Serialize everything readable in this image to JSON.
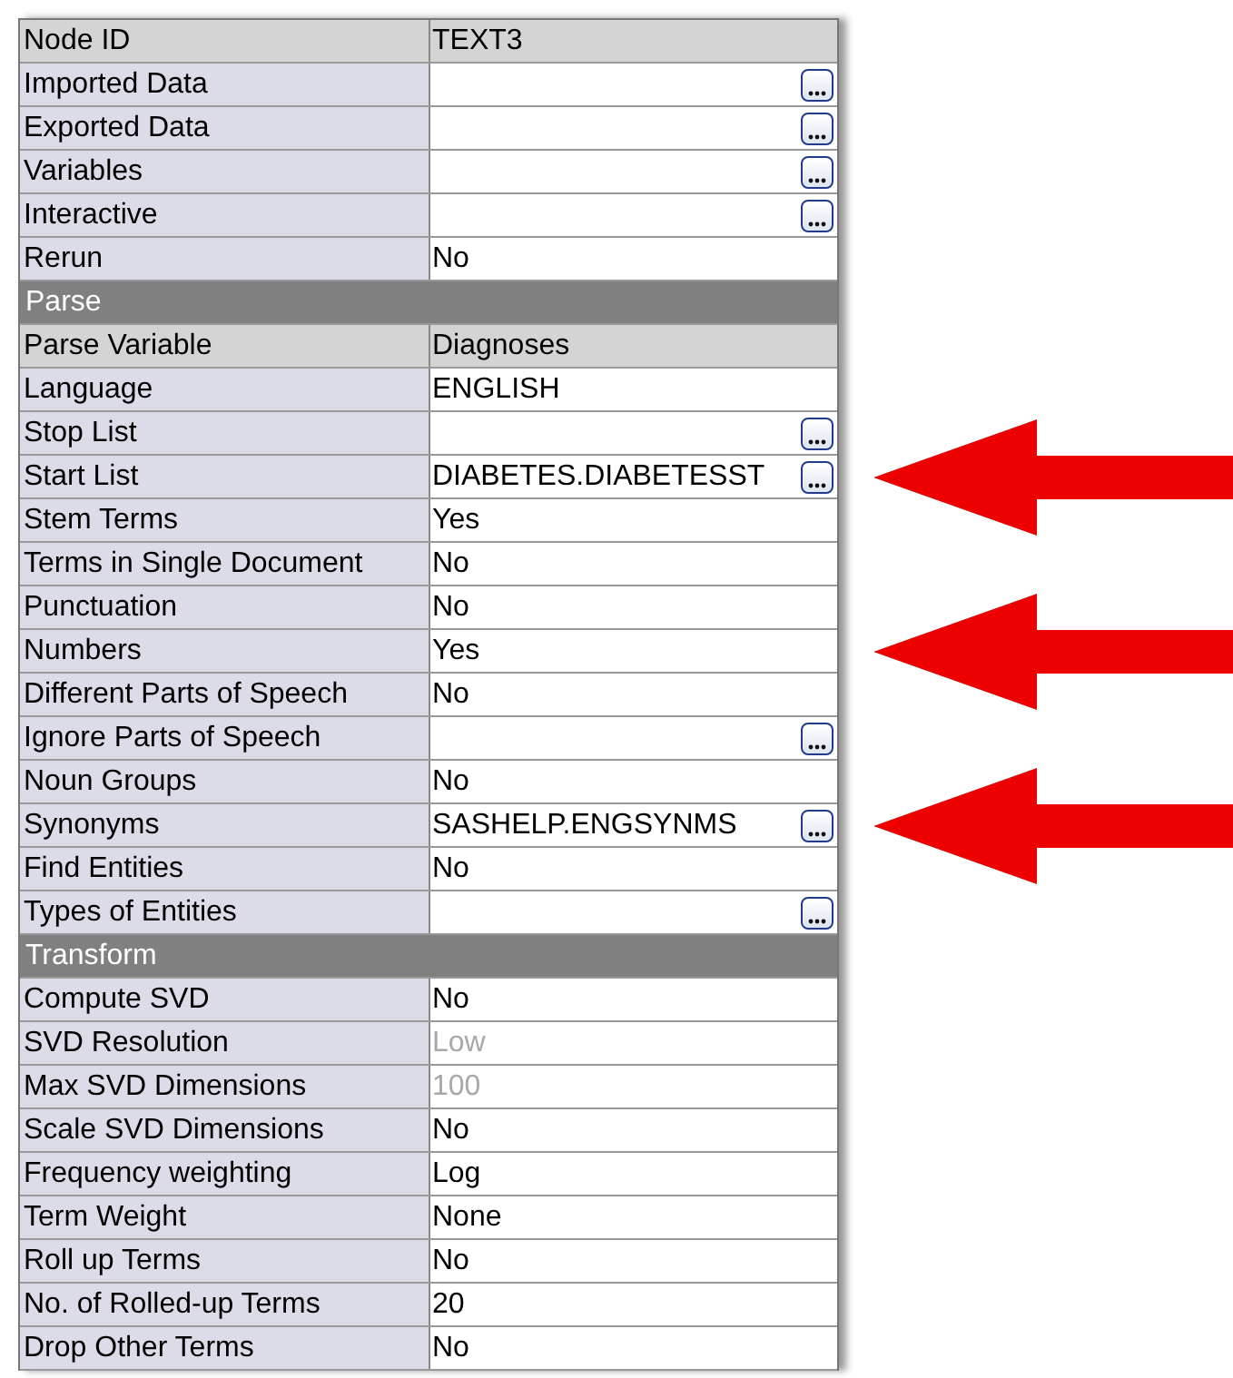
{
  "properties": [
    {
      "kind": "readonly",
      "label": "Node ID",
      "value": "TEXT3"
    },
    {
      "kind": "property",
      "label": "Imported Data",
      "button": true
    },
    {
      "kind": "property",
      "label": "Exported Data",
      "button": true
    },
    {
      "kind": "property",
      "label": "Variables",
      "button": true
    },
    {
      "kind": "property",
      "label": "Interactive",
      "button": true
    },
    {
      "kind": "property",
      "label": "Rerun",
      "value": "No"
    },
    {
      "kind": "section",
      "label": "Parse"
    },
    {
      "kind": "readonly",
      "label": "Parse Variable",
      "value": "Diagnoses"
    },
    {
      "kind": "property",
      "label": "Language",
      "value": "ENGLISH"
    },
    {
      "kind": "property",
      "label": "Stop List",
      "button": true
    },
    {
      "kind": "property",
      "label": "Start List",
      "value": "DIABETES.DIABETESST",
      "button": true,
      "highlighted": true
    },
    {
      "kind": "property",
      "label": "Stem Terms",
      "value": "Yes"
    },
    {
      "kind": "property",
      "label": "Terms in Single Document",
      "value": "No"
    },
    {
      "kind": "property",
      "label": "Punctuation",
      "value": "No"
    },
    {
      "kind": "property",
      "label": "Numbers",
      "value": "Yes",
      "highlighted": true
    },
    {
      "kind": "property",
      "label": "Different Parts of Speech",
      "value": "No"
    },
    {
      "kind": "property",
      "label": "Ignore Parts of Speech",
      "button": true
    },
    {
      "kind": "property",
      "label": "Noun Groups",
      "value": "No"
    },
    {
      "kind": "property",
      "label": "Synonyms",
      "value": "SASHELP.ENGSYNMS",
      "button": true,
      "highlighted": true
    },
    {
      "kind": "property",
      "label": "Find Entities",
      "value": "No"
    },
    {
      "kind": "property",
      "label": "Types of Entities",
      "button": true
    },
    {
      "kind": "section",
      "label": "Transform"
    },
    {
      "kind": "property",
      "label": "Compute SVD",
      "value": "No"
    },
    {
      "kind": "property",
      "label": "SVD Resolution",
      "value": "Low",
      "disabled": true
    },
    {
      "kind": "property",
      "label": "Max SVD Dimensions",
      "value": "100",
      "disabled": true
    },
    {
      "kind": "property",
      "label": "Scale SVD Dimensions",
      "value": "No"
    },
    {
      "kind": "property",
      "label": "Frequency weighting",
      "value": "Log"
    },
    {
      "kind": "property",
      "label": "Term Weight",
      "value": "None"
    },
    {
      "kind": "property",
      "label": "Roll up Terms",
      "value": "No"
    },
    {
      "kind": "property",
      "label": "No. of Rolled-up Terms",
      "value": "20"
    },
    {
      "kind": "property",
      "label": "Drop Other Terms",
      "value": "No"
    }
  ]
}
